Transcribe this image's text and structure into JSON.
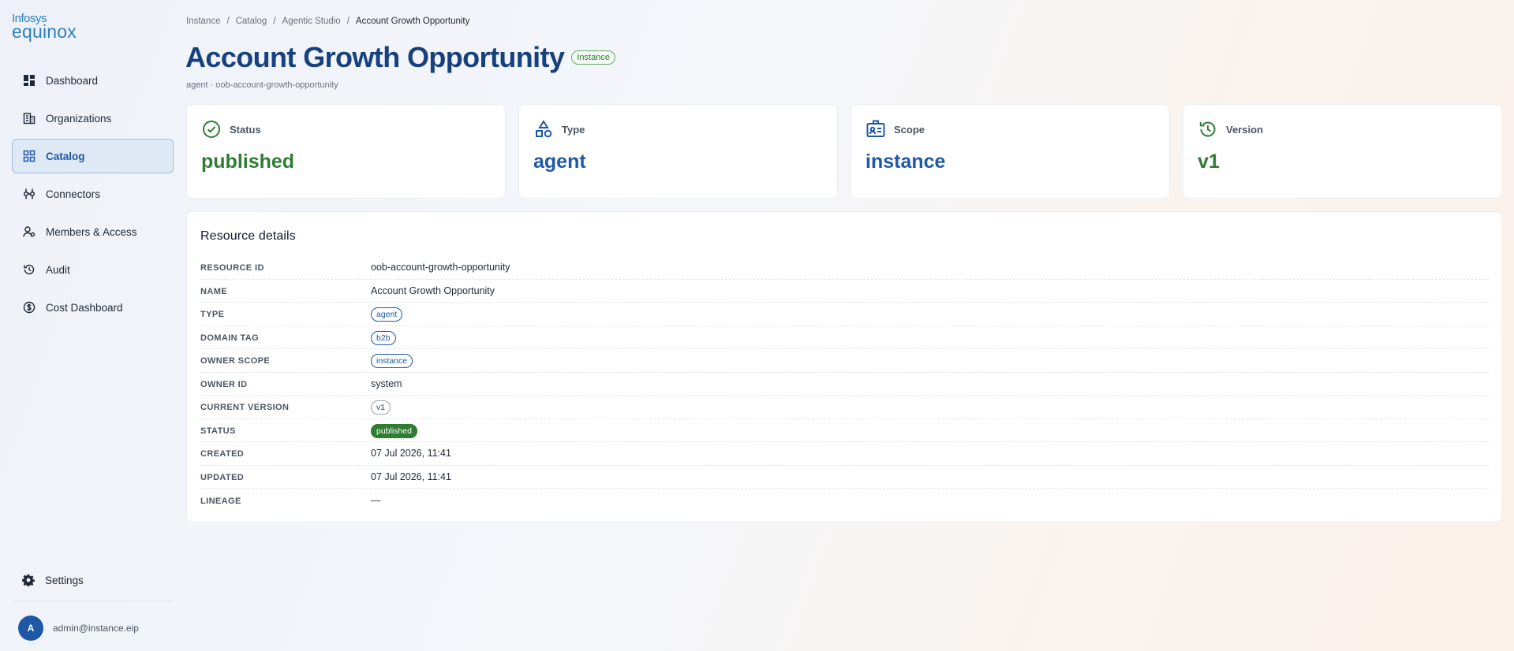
{
  "brand": {
    "line1": "Infosys",
    "line2": "equinox"
  },
  "sidebar": {
    "items": [
      {
        "label": "Dashboard",
        "icon": "dashboard-icon"
      },
      {
        "label": "Organizations",
        "icon": "building-icon"
      },
      {
        "label": "Catalog",
        "icon": "grid-icon",
        "active": true
      },
      {
        "label": "Connectors",
        "icon": "connector-icon"
      },
      {
        "label": "Members & Access",
        "icon": "users-icon"
      },
      {
        "label": "Audit",
        "icon": "history-icon"
      },
      {
        "label": "Cost Dashboard",
        "icon": "dollar-icon"
      }
    ],
    "settings_label": "Settings",
    "user": {
      "initial": "A",
      "email": "admin@instance.eip"
    }
  },
  "breadcrumb": [
    "Instance",
    "Catalog",
    "Agentic Studio",
    "Account Growth Opportunity"
  ],
  "header": {
    "title": "Account Growth Opportunity",
    "badge": "Instance",
    "subtitle": "agent · oob-account-growth-opportunity"
  },
  "cards": [
    {
      "label": "Status",
      "value": "published",
      "icon": "check-circle-icon",
      "color": "#2e7d32"
    },
    {
      "label": "Type",
      "value": "agent",
      "icon": "shapes-icon",
      "color": "#1f58a6"
    },
    {
      "label": "Scope",
      "value": "instance",
      "icon": "id-badge-icon",
      "color": "#1f58a6"
    },
    {
      "label": "Version",
      "value": "v1",
      "icon": "history-icon",
      "color": "#2e7d32"
    }
  ],
  "details": {
    "title": "Resource details",
    "rows": [
      {
        "key": "RESOURCE ID",
        "value": "oob-account-growth-opportunity"
      },
      {
        "key": "NAME",
        "value": "Account Growth Opportunity"
      },
      {
        "key": "TYPE",
        "value": "agent"
      },
      {
        "key": "DOMAIN TAG",
        "value": "b2b"
      },
      {
        "key": "OWNER SCOPE",
        "value": "instance"
      },
      {
        "key": "OWNER ID",
        "value": "system"
      },
      {
        "key": "CURRENT VERSION",
        "value": "v1"
      },
      {
        "key": "STATUS",
        "value": "published"
      },
      {
        "key": "CREATED",
        "value": "07 Jul 2026, 11:41"
      },
      {
        "key": "UPDATED",
        "value": "07 Jul 2026, 11:41"
      },
      {
        "key": "LINEAGE",
        "value": "—"
      }
    ]
  }
}
